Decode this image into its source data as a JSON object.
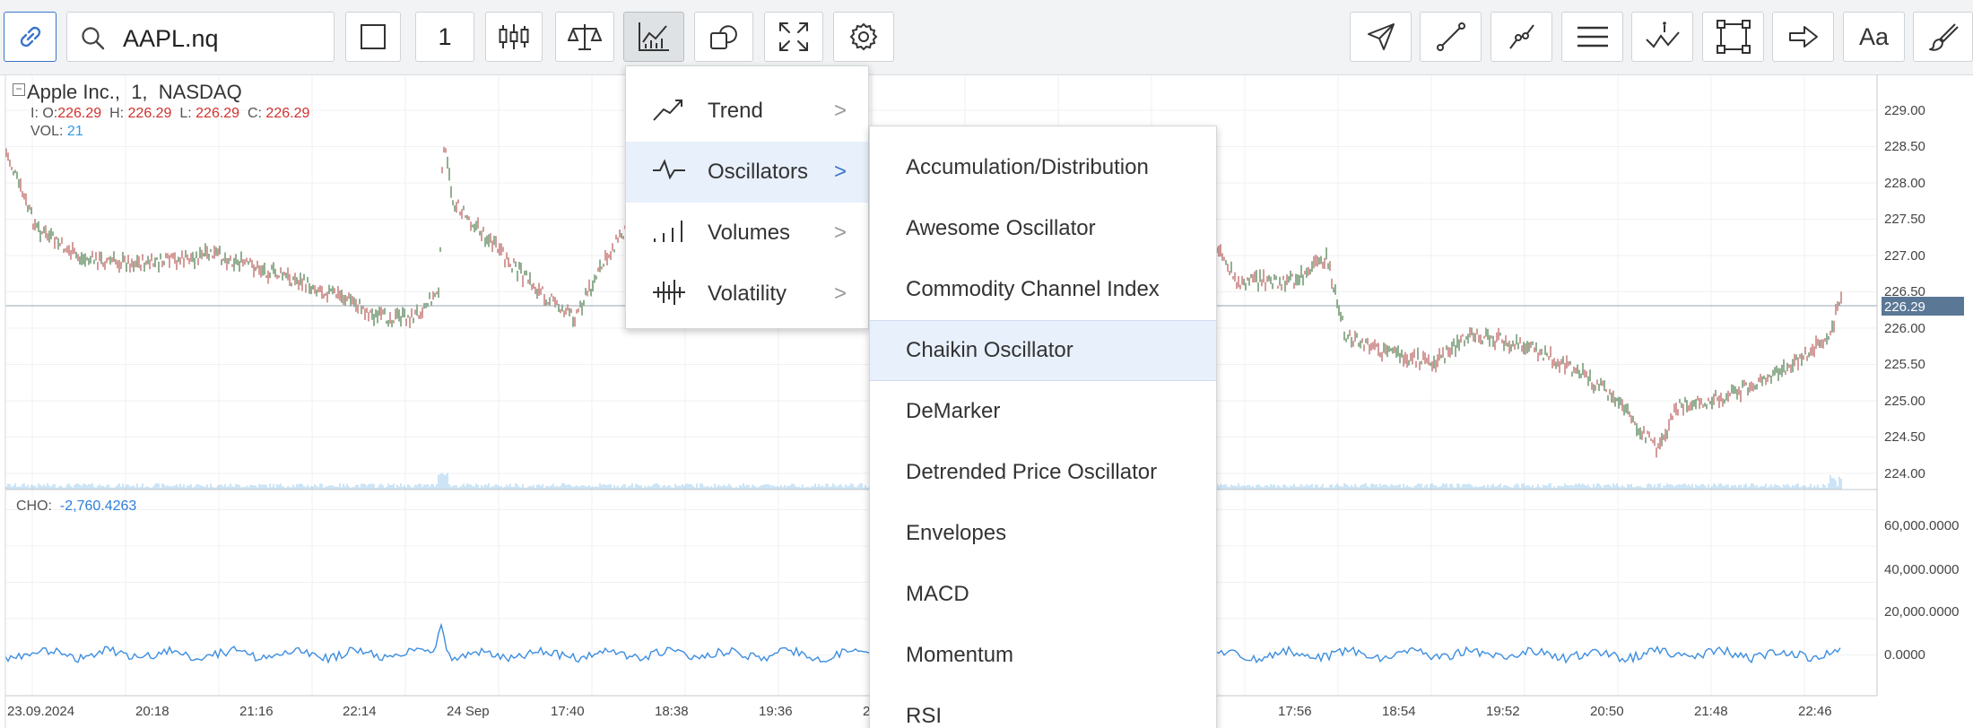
{
  "toolbar": {
    "search_value": "AAPL.nq",
    "interval_value": "1"
  },
  "legend": {
    "title_name": "Apple Inc.,",
    "title_interval": "1,",
    "title_exchange": "NASDAQ",
    "ohlc_prefix": "I:",
    "o_label": "O:",
    "o_value": "226.29",
    "h_label": "H:",
    "h_value": "226.29",
    "l_label": "L:",
    "l_value": "226.29",
    "c_label": "C:",
    "c_value": "226.29",
    "vol_label": "VOL:",
    "vol_value": "21",
    "cho_label": "CHO:",
    "cho_value": "-2,760.4263"
  },
  "price_axis": {
    "ticks": [
      "229.00",
      "228.50",
      "228.00",
      "227.50",
      "227.00",
      "226.50",
      "226.00",
      "225.50",
      "225.00",
      "224.50",
      "224.00"
    ],
    "current_price": "226.29"
  },
  "osc_axis": {
    "ticks": [
      "60,000.0000",
      "40,000.0000",
      "20,000.0000",
      "0.0000"
    ]
  },
  "time_axis": {
    "ticks": [
      "23.09.2024",
      "20:18",
      "21:16",
      "22:14",
      "24 Sep",
      "17:40",
      "18:38",
      "19:36",
      "2",
      "17:56",
      "18:54",
      "19:52",
      "20:50",
      "21:48",
      "22:46"
    ]
  },
  "indicator_menu": {
    "items": [
      {
        "label": "Trend",
        "icon": "trend-icon"
      },
      {
        "label": "Oscillators",
        "icon": "oscillator-icon"
      },
      {
        "label": "Volumes",
        "icon": "volume-icon"
      },
      {
        "label": "Volatility",
        "icon": "volatility-icon"
      }
    ],
    "chevron": ">"
  },
  "oscillators_submenu": {
    "items": [
      "Accumulation/Distribution",
      "Awesome Oscillator",
      "Commodity Channel Index",
      "Chaikin Oscillator",
      "DeMarker",
      "Detrended Price Oscillator",
      "Envelopes",
      "MACD",
      "Momentum",
      "RSI"
    ],
    "highlighted": "Chaikin Oscillator"
  },
  "colors": {
    "accent": "#3a74c9",
    "up_red": "#d0312d",
    "candle_green": "#4a7a4a",
    "volume_blue": "#a9d3f0",
    "oscillator_line": "#3d8ee0",
    "price_label_bg": "#5b7796"
  }
}
